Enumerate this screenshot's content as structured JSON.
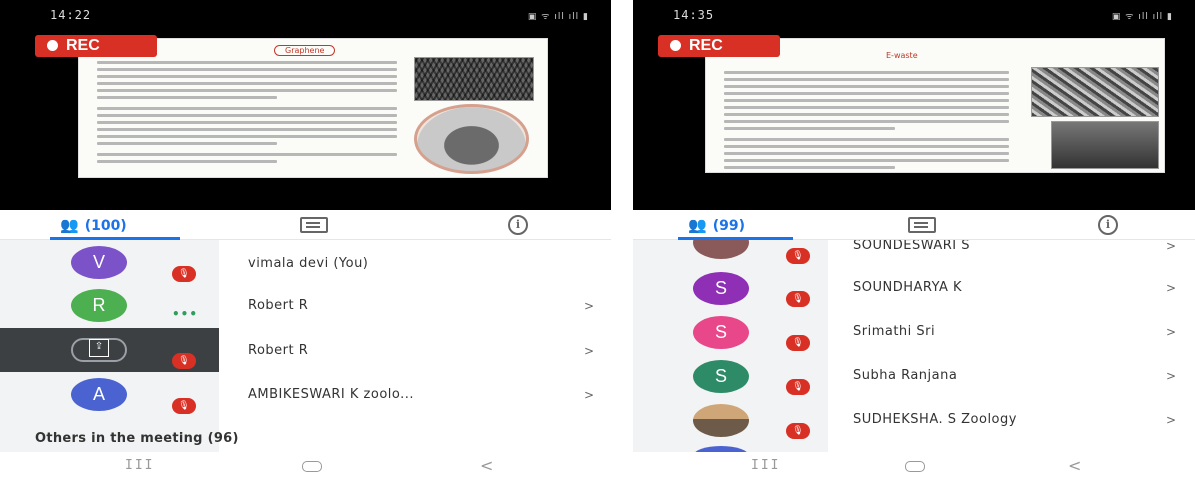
{
  "left": {
    "status": {
      "time": "14:22"
    },
    "recording_label": "REC",
    "slide": {
      "title": "Graphene"
    },
    "tabs": {
      "people_count": "(100)"
    },
    "participants": [
      {
        "initial": "V",
        "name": "vimala devi (You)",
        "avatar_color": "#7b52c8",
        "muted": true
      },
      {
        "initial": "R",
        "name": "Robert R",
        "avatar_color": "#4caf50",
        "muted": false,
        "speaking": true
      },
      {
        "initial": "",
        "name": "Robert R",
        "presenting": true,
        "muted": true
      },
      {
        "initial": "A",
        "name": "AMBIKESWARI K zoolo...",
        "avatar_color": "#4a63d1",
        "muted": true
      }
    ],
    "others_heading": "Others in the meeting (96)"
  },
  "right": {
    "status": {
      "time": "14:35"
    },
    "recording_label": "REC",
    "slide": {
      "title": "E-waste"
    },
    "tabs": {
      "people_count": "(99)"
    },
    "participants": [
      {
        "initial": "",
        "name": "SOUNDESWARI S",
        "avatar_color": "#8a5a5a",
        "muted": true
      },
      {
        "initial": "S",
        "name": "SOUNDHARYA K",
        "avatar_color": "#8e2fb5",
        "muted": true
      },
      {
        "initial": "S",
        "name": "Srimathi Sri",
        "avatar_color": "#e8478a",
        "muted": true
      },
      {
        "initial": "S",
        "name": "Subha Ranjana",
        "avatar_color": "#2e8b68",
        "muted": true
      },
      {
        "initial": "",
        "name": "SUDHEKSHA. S Zoology",
        "avatar_color": "#9c8b7a",
        "muted": true
      }
    ]
  },
  "chevron": ">",
  "status_icons": "▣ ᯤ ıll ıll ▮",
  "nav": {
    "recent": "III",
    "back": "<"
  },
  "colors": {
    "accent": "#1a73e8",
    "rec": "#d93025",
    "muted_badge": "#d93025",
    "panel_bg": "#f1f3f4"
  }
}
